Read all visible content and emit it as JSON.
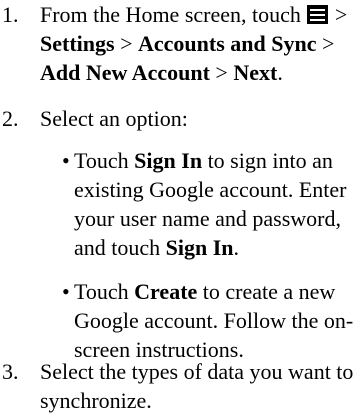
{
  "steps": [
    {
      "number": "1.",
      "line1_pre": "From the Home screen, touch",
      "line1_post": " >",
      "settings": "Settings",
      "sep1": " > ",
      "accounts_sync": "Accounts and Sync",
      "sep2": " >",
      "add_account": "Add New Account",
      "sep3": " > ",
      "next": "Next",
      "end": "."
    },
    {
      "number": "2.",
      "text": "Select an option:",
      "bullets": [
        {
          "mark": "•",
          "pre": "Touch ",
          "bold1": "Sign In",
          "mid": " to sign into an existing Google account. Enter your user name and password, and touch ",
          "bold2": "Sign In",
          "post": "."
        },
        {
          "mark": "•",
          "pre": "Touch ",
          "bold1": "Create",
          "mid": " to create a new Google account. Follow the on-screen instructions."
        }
      ]
    },
    {
      "number": "3.",
      "text": "Select the types of data you want to synchronize."
    }
  ],
  "icons": {
    "menu": "menu-icon"
  }
}
